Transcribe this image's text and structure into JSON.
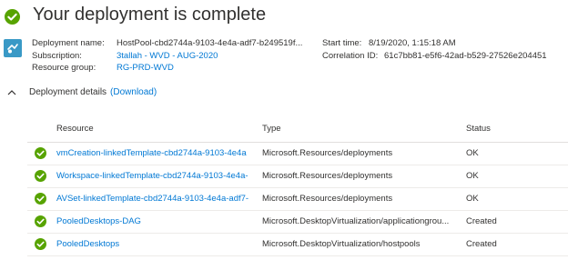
{
  "header": {
    "title": "Your deployment is complete",
    "status_color": "#57a300"
  },
  "summary": {
    "deployment_name_label": "Deployment name:",
    "deployment_name": "HostPool-cbd2744a-9103-4e4a-adf7-b249519f...",
    "subscription_label": "Subscription:",
    "subscription": "3tallah - WVD - AUG-2020",
    "resource_group_label": "Resource group:",
    "resource_group": "RG-PRD-WVD",
    "start_time_label": "Start time:",
    "start_time": "8/19/2020, 1:15:18 AM",
    "correlation_label": "Correlation ID:",
    "correlation_id": "61c7bb81-e5f6-42ad-b529-27526e204451"
  },
  "details": {
    "title": "Deployment details",
    "download_label": "(Download)"
  },
  "table": {
    "columns": [
      "Resource",
      "Type",
      "Status"
    ],
    "rows": [
      {
        "resource": "vmCreation-linkedTemplate-cbd2744a-9103-4e4a",
        "type": "Microsoft.Resources/deployments",
        "status": "OK"
      },
      {
        "resource": "Workspace-linkedTemplate-cbd2744a-9103-4e4a-",
        "type": "Microsoft.Resources/deployments",
        "status": "OK"
      },
      {
        "resource": "AVSet-linkedTemplate-cbd2744a-9103-4e4a-adf7-",
        "type": "Microsoft.Resources/deployments",
        "status": "OK"
      },
      {
        "resource": "PooledDesktops-DAG",
        "type": "Microsoft.DesktopVirtualization/applicationgrou...",
        "status": "Created"
      },
      {
        "resource": "PooledDesktops",
        "type": "Microsoft.DesktopVirtualization/hostpools",
        "status": "Created"
      }
    ]
  },
  "colors": {
    "link": "#0078d4",
    "success": "#57a300",
    "deploy_icon": "#3999c6"
  },
  "icons": {
    "header_status": "check-circle-icon",
    "deployment": "deployment-icon",
    "toggle": "chevron-up-icon",
    "row_status": "check-circle-icon"
  }
}
